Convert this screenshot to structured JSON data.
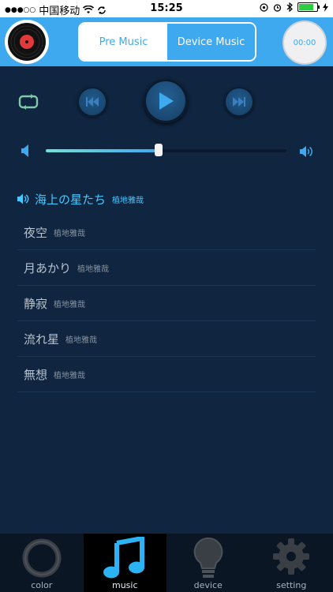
{
  "status_bar": {
    "signal_dots": "●●●○○",
    "carrier": "中国移动",
    "time": "15:25",
    "battery_level": 0.85
  },
  "header": {
    "segments": [
      "Pre Music",
      "Device Music"
    ],
    "selected_segment": "Device Music",
    "timer": "00:00"
  },
  "player": {
    "volume_level": 0.47
  },
  "playlist": [
    {
      "title": "海上の星たち",
      "artist": "植地雅哉",
      "playing": true
    },
    {
      "title": "夜空",
      "artist": "植地雅哉",
      "playing": false
    },
    {
      "title": "月あかり",
      "artist": "植地雅哉",
      "playing": false
    },
    {
      "title": "静寂",
      "artist": "植地雅哉",
      "playing": false
    },
    {
      "title": "流れ星",
      "artist": "植地雅哉",
      "playing": false
    },
    {
      "title": "無想",
      "artist": "植地雅哉",
      "playing": false
    }
  ],
  "tabs": [
    "color",
    "music",
    "device",
    "setting"
  ],
  "active_tab": "music",
  "colors": {
    "accent": "#3ea9ef",
    "background": "#0f2540",
    "playing_text": "#44c8ff"
  }
}
